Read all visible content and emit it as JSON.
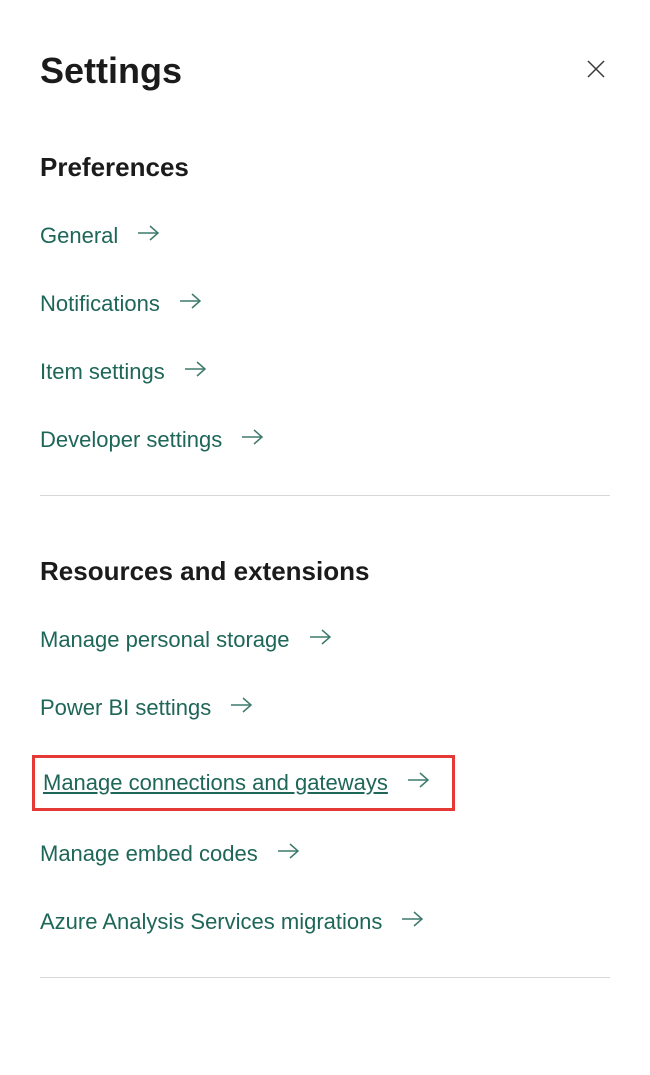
{
  "header": {
    "title": "Settings"
  },
  "sections": {
    "preferences": {
      "title": "Preferences",
      "items": [
        {
          "label": "General"
        },
        {
          "label": "Notifications"
        },
        {
          "label": "Item settings"
        },
        {
          "label": "Developer settings"
        }
      ]
    },
    "resources": {
      "title": "Resources and extensions",
      "items": [
        {
          "label": "Manage personal storage"
        },
        {
          "label": "Power BI settings"
        },
        {
          "label": "Manage connections and gateways"
        },
        {
          "label": "Manage embed codes"
        },
        {
          "label": "Azure Analysis Services migrations"
        }
      ]
    }
  },
  "colors": {
    "link": "#1e6658",
    "highlight": "#e53935"
  }
}
